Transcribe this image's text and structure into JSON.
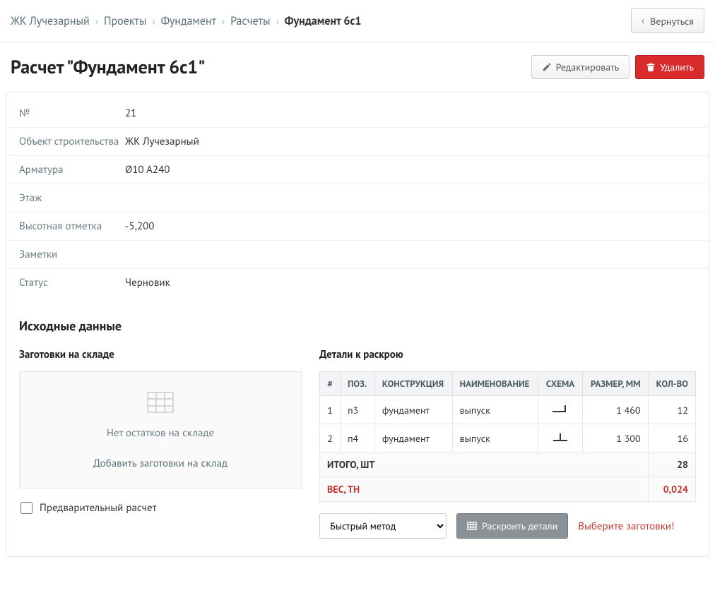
{
  "breadcrumb": {
    "items": [
      "ЖК Лучезарный",
      "Проекты",
      "Фундамент",
      "Расчеты"
    ],
    "current": "Фундамент 6с1"
  },
  "buttons": {
    "back": "Вернуться",
    "edit": "Редактировать",
    "delete": "Удалить",
    "calc": "Раскроить детали",
    "add_stock": "Добавить заготовки на склад"
  },
  "title": "Расчет \"Фундамент 6с1\"",
  "info": {
    "rows": [
      {
        "label": "№",
        "value": "21"
      },
      {
        "label": "Объект строительства",
        "value": "ЖК Лучезарный"
      },
      {
        "label": "Арматура",
        "value": "Ø10 A240"
      },
      {
        "label": "Этаж",
        "value": ""
      },
      {
        "label": "Высотная отметка",
        "value": "-5,200"
      },
      {
        "label": "Заметки",
        "value": ""
      },
      {
        "label": "Статус",
        "value": "Черновик"
      }
    ]
  },
  "section_source": "Исходные данные",
  "stock": {
    "title": "Заготовки на складе",
    "empty": "Нет остатков на складе",
    "preliminary": "Предварительный расчет"
  },
  "details": {
    "title": "Детали к раскрою",
    "headers": {
      "idx": "#",
      "pos": "ПОЗ.",
      "construction": "КОНСТРУКЦИЯ",
      "name": "НАИМЕНОВАНИЕ",
      "scheme": "СХЕМА",
      "size": "РАЗМЕР, ММ",
      "qty": "КОЛ-ВО"
    },
    "rows": [
      {
        "idx": "1",
        "pos": "п3",
        "construction": "фундамент",
        "name": "выпуск",
        "scheme": "corner",
        "size": "1 460",
        "qty": "12"
      },
      {
        "idx": "2",
        "pos": "п4",
        "construction": "фундамент",
        "name": "выпуск",
        "scheme": "tee",
        "size": "1 300",
        "qty": "16"
      }
    ],
    "total_label": "ИТОГО, ШТ",
    "total_value": "28",
    "weight_label": "ВЕС, ТН",
    "weight_value": "0,024"
  },
  "method": {
    "selected": "Быстрый метод"
  },
  "warning": "Выберите заготовки!"
}
